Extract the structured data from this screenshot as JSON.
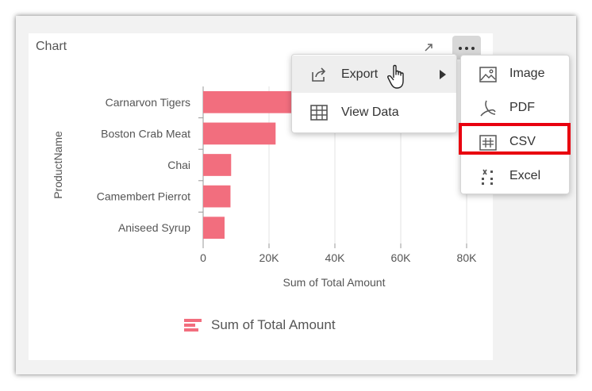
{
  "card": {
    "title": "Chart"
  },
  "icons": {
    "expand": "expand-icon",
    "more": "more-options-icon",
    "export": "export-icon",
    "view_data": "table-icon",
    "image": "image-icon",
    "pdf": "pdf-icon",
    "csv": "csv-icon",
    "excel": "excel-icon",
    "cursor": "hand-pointer-icon"
  },
  "menu": {
    "items": [
      {
        "label": "Export",
        "has_submenu": true,
        "hovered": true
      },
      {
        "label": "View Data"
      }
    ]
  },
  "export_menu": {
    "items": [
      {
        "label": "Image"
      },
      {
        "label": "PDF"
      },
      {
        "label": "CSV",
        "highlighted": true
      },
      {
        "label": "Excel"
      }
    ]
  },
  "colors": {
    "bar": "#f26e7e",
    "highlight": "#e8000f",
    "menu_hover": "#eeeeee"
  },
  "chart_data": {
    "type": "bar",
    "orientation": "horizontal",
    "categories": [
      "Carnarvon Tigers",
      "Boston Crab Meat",
      "Chai",
      "Camembert Pierrot",
      "Aniseed Syrup"
    ],
    "series": [
      {
        "name": "Sum of Total Amount",
        "values": [
          29000,
          22000,
          8500,
          8300,
          6500
        ]
      }
    ],
    "xlabel": "Sum of Total Amount",
    "ylabel": "ProductName",
    "xlim": [
      0,
      80000
    ],
    "x_ticks": [
      "0",
      "20K",
      "40K",
      "60K",
      "80K"
    ],
    "grid": true,
    "legend": {
      "position": "bottom",
      "entries": [
        "Sum of Total Amount"
      ]
    }
  }
}
